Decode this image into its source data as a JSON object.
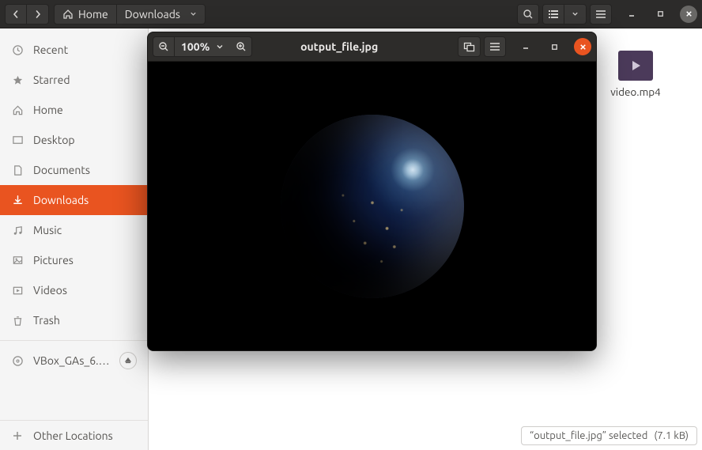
{
  "fm": {
    "breadcrumb": {
      "home": "Home",
      "current": "Downloads"
    },
    "sidebar": {
      "items": [
        {
          "label": "Recent"
        },
        {
          "label": "Starred"
        },
        {
          "label": "Home"
        },
        {
          "label": "Desktop"
        },
        {
          "label": "Documents"
        },
        {
          "label": "Downloads"
        },
        {
          "label": "Music"
        },
        {
          "label": "Pictures"
        },
        {
          "label": "Videos"
        },
        {
          "label": "Trash"
        }
      ],
      "mount": {
        "label": "VBox_GAs_6.…"
      },
      "other": {
        "label": "Other Locations"
      }
    },
    "files": {
      "video": {
        "name": "video.mp4"
      }
    },
    "status": {
      "text": "“output_file.jpg” selected",
      "size": "(7.1 kB)"
    }
  },
  "viewer": {
    "title": "output_file.jpg",
    "zoom": "100%"
  }
}
